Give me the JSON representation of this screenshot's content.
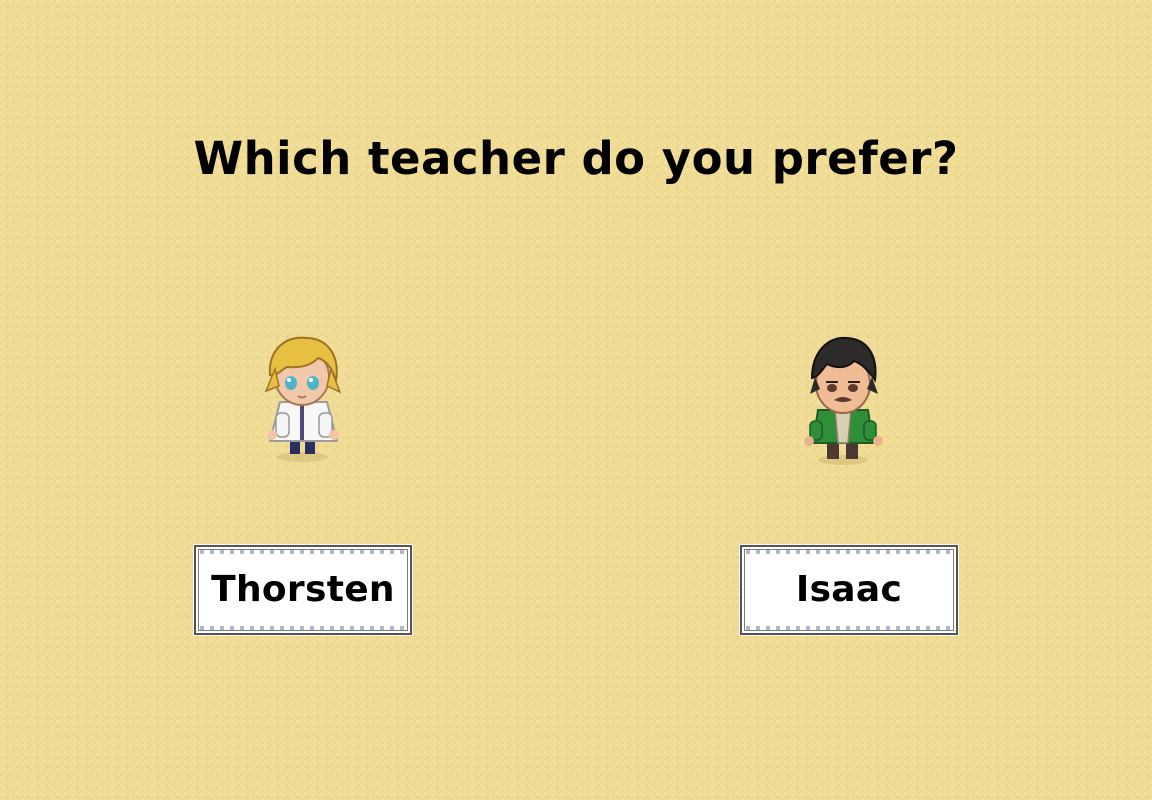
{
  "screen": {
    "title": "Which teacher do you prefer?"
  },
  "choices": [
    {
      "name": "Thorsten",
      "sprite": "blonde-teacher-sprite"
    },
    {
      "name": "Isaac",
      "sprite": "dark-haired-teacher-sprite"
    }
  ]
}
